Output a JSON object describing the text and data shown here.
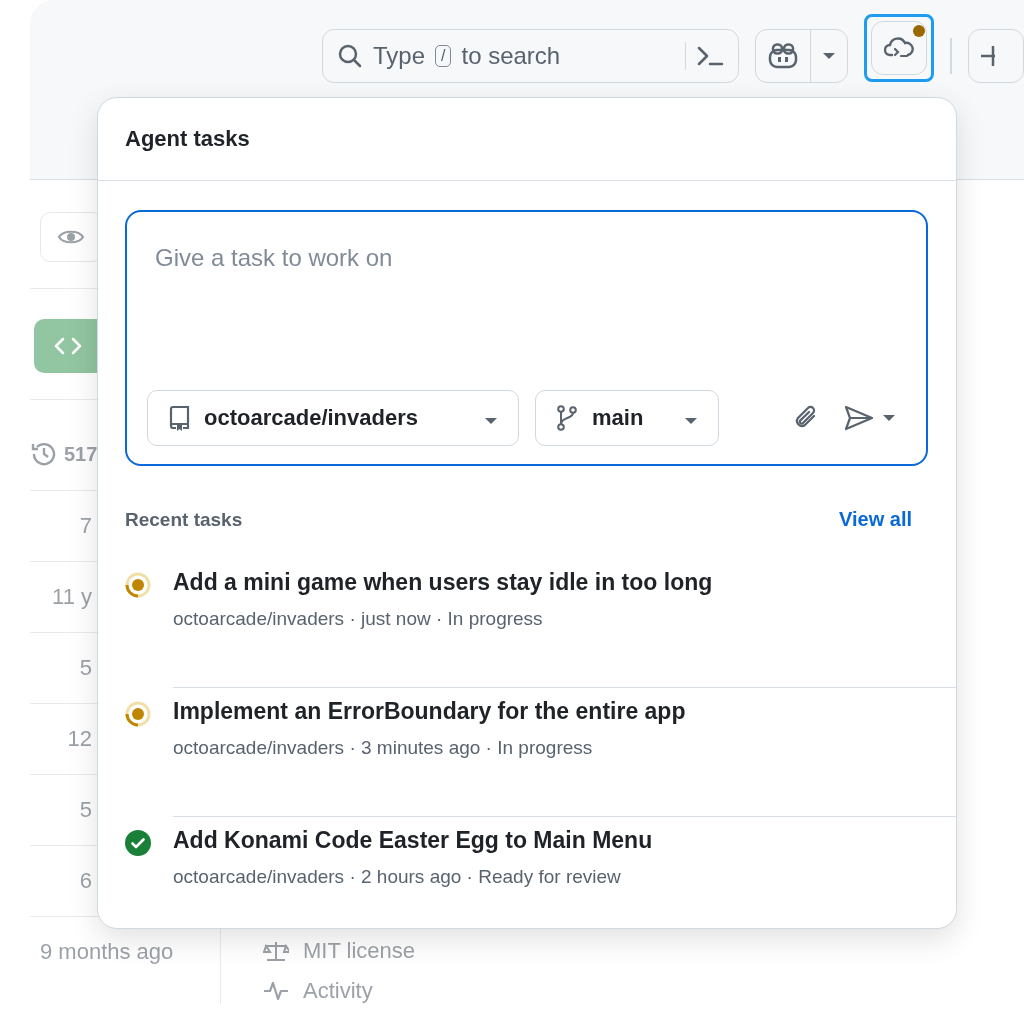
{
  "header": {
    "search": {
      "prefix": "Type",
      "key": "/",
      "suffix": "to search"
    },
    "agent_button": {
      "focused": true,
      "notification": true
    }
  },
  "background": {
    "commits": "517",
    "ages": [
      "7",
      "11 y",
      "5",
      "12",
      "5",
      "6",
      "9 months ago"
    ],
    "sidebar_links": [
      "MIT license",
      "Activity"
    ]
  },
  "agent_tasks": {
    "title": "Agent tasks",
    "composer": {
      "placeholder": "Give a task to work on",
      "repository": "octoarcade/invaders",
      "branch": "main"
    },
    "recent_heading": "Recent tasks",
    "view_all": "View all",
    "tasks": [
      {
        "title": "Add a mini game when users stay idle in too long",
        "meta": "octoarcade/invaders · just now · In progress",
        "kind": "running"
      },
      {
        "title": "Implement an ErrorBoundary for the entire app",
        "meta": "octoarcade/invaders · 3 minutes ago · In progress",
        "kind": "running"
      },
      {
        "title": "Add Konami Code Easter Egg to Main Menu",
        "meta": "octoarcade/invaders · 2 hours ago · Ready for review",
        "kind": "done"
      }
    ]
  }
}
